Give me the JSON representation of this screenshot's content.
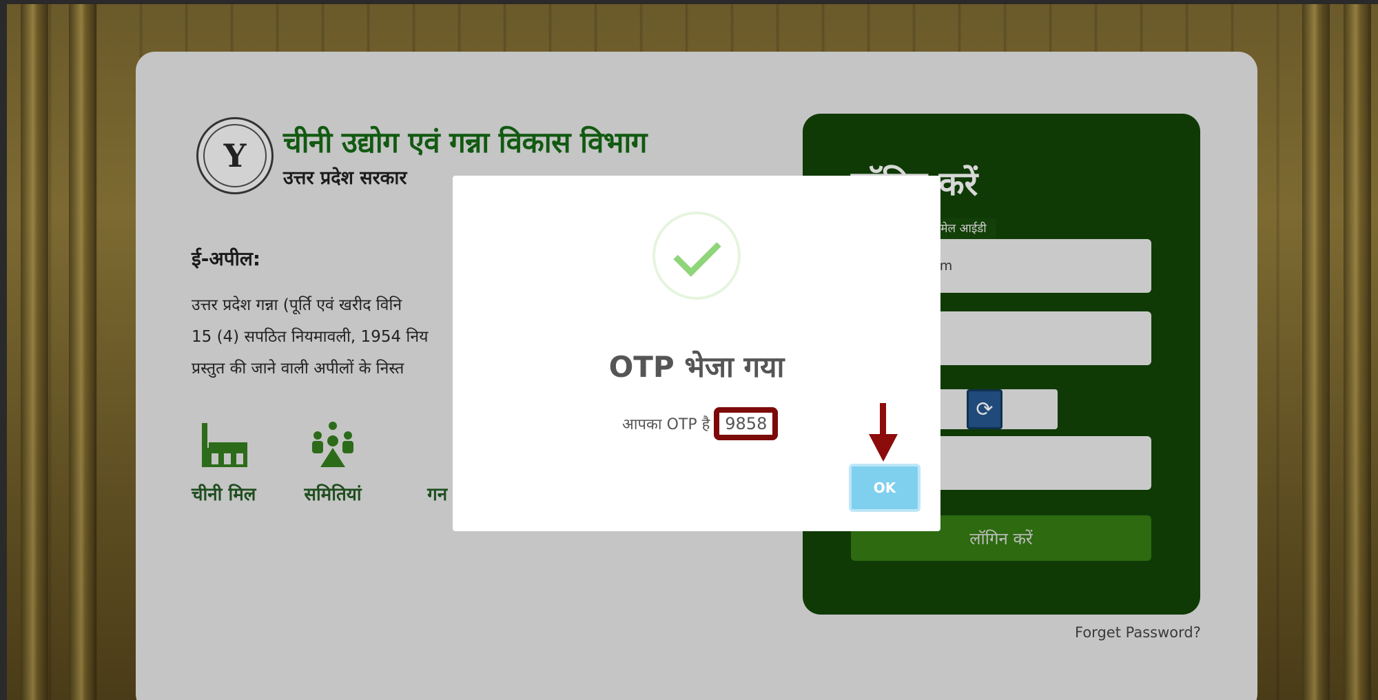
{
  "header": {
    "department": "चीनी उद्योग एवं गन्ना विकास विभाग",
    "government": "उत्तर प्रदेश सरकार"
  },
  "eappeal": {
    "title": "ई-अपील:",
    "lines": [
      "उत्तर प्रदेश गन्ना (पूर्ति एवं खरीद विनि",
      "15 (4) सपठित नियमावली, 1954 निय",
      "प्रस्तुत की जाने वाली अपीलों के निस्त"
    ]
  },
  "features": [
    {
      "label": "चीनी मिल",
      "icon": "factory-icon"
    },
    {
      "label": "समितियां",
      "icon": "committee-icon"
    },
    {
      "label": "गन",
      "icon": "sugarcane-icon"
    }
  ],
  "login": {
    "title": "लॉगिन करें",
    "email_tag": "ईमेल आईडी",
    "email_value": "dalsugar.com",
    "login_button": "लॉगिन करें",
    "refresh_icon": "refresh-icon"
  },
  "forget_password": "Forget Password?",
  "modal": {
    "title": "OTP भेजा गया",
    "message": "आपका OTP है",
    "otp": "9858",
    "ok_label": "OK",
    "accent": "#8fd57a",
    "highlight": "#7c0a0a"
  }
}
